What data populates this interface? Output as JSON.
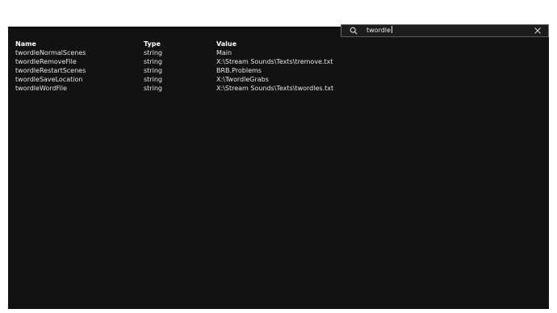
{
  "search": {
    "value": "twordle",
    "icon": "search-icon",
    "clear_icon": "close-icon"
  },
  "table": {
    "columns": [
      "Name",
      "Type",
      "Value"
    ],
    "rows": [
      {
        "name": "twordleNormalScenes",
        "type": "string",
        "value": "Main"
      },
      {
        "name": "twordleRemoveFile",
        "type": "string",
        "value": "X:\\Stream Sounds\\Texts\\tremove.txt"
      },
      {
        "name": "twordleRestartScenes",
        "type": "string",
        "value": "BRB.Problems"
      },
      {
        "name": "twordleSaveLocation",
        "type": "string",
        "value": "X:\\TwordleGrabs"
      },
      {
        "name": "twordleWordFile",
        "type": "string",
        "value": "X:\\Stream Sounds\\Texts\\twordles.txt"
      }
    ]
  },
  "colors": {
    "panel_bg": "#121212",
    "text": "#e6e6e6",
    "border": "#6d6d6d"
  }
}
